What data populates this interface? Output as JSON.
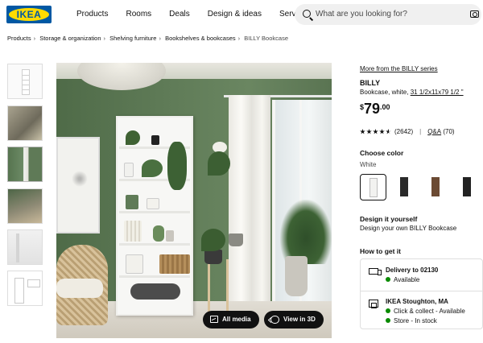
{
  "header": {
    "logo_text": "IKEA",
    "nav": [
      "Products",
      "Rooms",
      "Deals",
      "Design & ideas",
      "Services"
    ],
    "search_placeholder": "What are you looking for?"
  },
  "breadcrumb": [
    "Products",
    "Storage & organization",
    "Shelving furniture",
    "Bookshelves & bookcases",
    "BILLY Bookcase"
  ],
  "gallery": {
    "all_media_label": "All media",
    "view_3d_label": "View in 3D"
  },
  "product": {
    "series_link": "More from the BILLY series",
    "name": "BILLY",
    "description": "Bookcase, white, ",
    "measurement": "31 1/2x11x79 1/2 \"",
    "price_currency": "$",
    "price_integer": "79",
    "price_decimal": ".00",
    "rating_value": 4.5,
    "review_count": "(2642)",
    "qa_label": "Q&A",
    "qa_count": "(70)",
    "choose_color_label": "Choose color",
    "color_selected": "White",
    "colors": [
      "#f2f2f0",
      "#2a2a2a",
      "#6b4a33",
      "#222222"
    ],
    "design_title": "Design it yourself",
    "design_subtitle": "Design your own BILLY Bookcase",
    "how_title": "How to get it",
    "delivery_title": "Delivery to 02130",
    "delivery_status": "Available",
    "store_title": "IKEA Stoughton, MA",
    "store_status_1": "Click & collect - Available",
    "store_status_2": "Store - In stock",
    "available_color": "#0a8a00"
  }
}
